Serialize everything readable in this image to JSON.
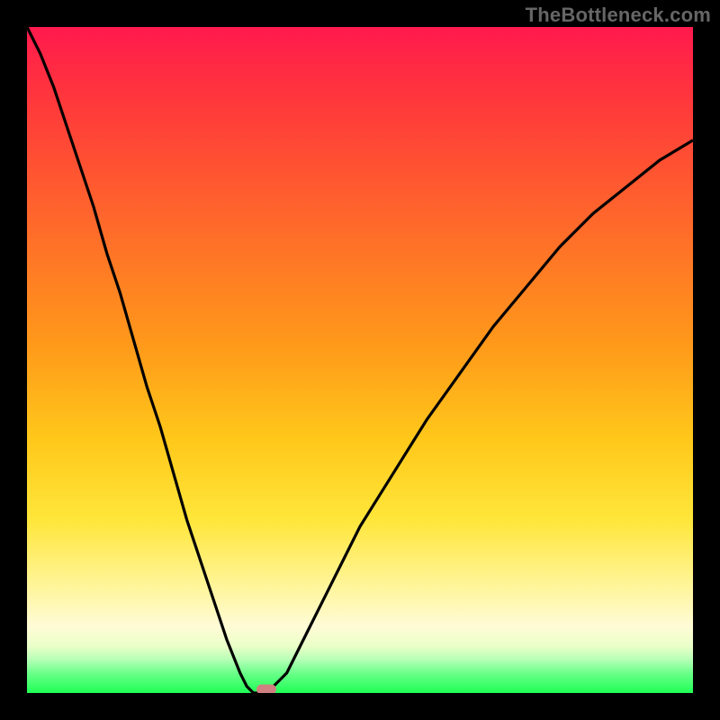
{
  "watermark": "TheBottleneck.com",
  "colors": {
    "frame": "#000000",
    "curve": "#000000",
    "marker": "#d08080",
    "gradient_stops": [
      "#ff1a4d",
      "#ff3a3a",
      "#ff6a2a",
      "#ff9a1a",
      "#ffc81a",
      "#ffe63a",
      "#fff59a",
      "#fffbd6",
      "#eaffc8",
      "#b6ffb6",
      "#6cff8a",
      "#1eff55"
    ]
  },
  "chart_data": {
    "type": "line",
    "title": "",
    "xlabel": "",
    "ylabel": "",
    "xlim": [
      0,
      100
    ],
    "ylim": [
      0,
      100
    ],
    "grid": false,
    "x": [
      0,
      2,
      4,
      6,
      8,
      10,
      12,
      14,
      16,
      18,
      20,
      22,
      24,
      26,
      28,
      30,
      32,
      33,
      34,
      35,
      36,
      37,
      38,
      39,
      40,
      42,
      44,
      46,
      48,
      50,
      55,
      60,
      65,
      70,
      75,
      80,
      85,
      90,
      95,
      100
    ],
    "values": [
      100,
      96,
      91,
      85,
      79,
      73,
      66,
      60,
      53,
      46,
      40,
      33,
      26,
      20,
      14,
      8,
      3,
      1,
      0,
      0,
      0,
      1,
      2,
      3,
      5,
      9,
      13,
      17,
      21,
      25,
      33,
      41,
      48,
      55,
      61,
      67,
      72,
      76,
      80,
      83
    ],
    "marker": {
      "x_pct": 36,
      "y_pct": 0
    },
    "description": "Single V-shaped bottleneck curve with vertex near x≈35–37 at y=0; background is a vertical rainbow gradient (red→green)."
  }
}
